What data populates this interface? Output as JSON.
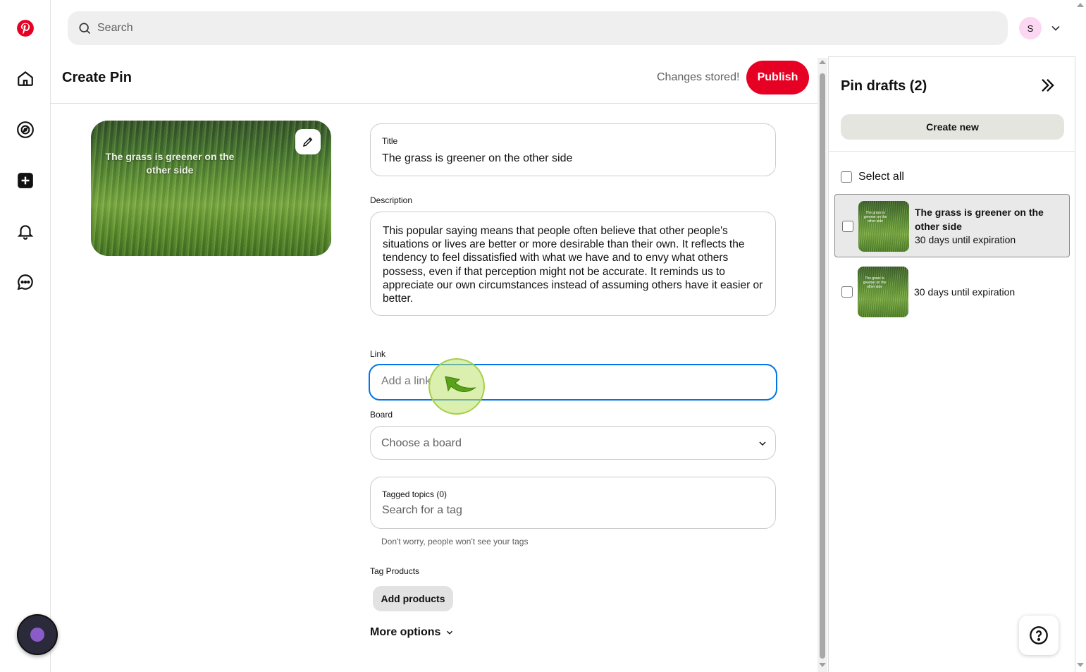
{
  "search": {
    "placeholder": "Search"
  },
  "account": {
    "avatar_initial": "S"
  },
  "header": {
    "title": "Create Pin",
    "status": "Changes stored!",
    "publish_label": "Publish"
  },
  "pin": {
    "overlay_text": "The grass is greener on the other side"
  },
  "form": {
    "title_label": "Title",
    "title_value": "The grass is greener on the other side",
    "description_label": "Description",
    "description_value": "This popular saying means that people often believe that other people's situations or lives are better or more desirable than their own. It reflects the tendency to feel dissatisfied with what we have and to envy what others possess, even if that perception might not be accurate. It reminds us to appreciate our own circumstances instead of assuming others have it easier or better.",
    "link_label": "Link",
    "link_placeholder": "Add a link",
    "board_label": "Board",
    "board_value": "Choose a board",
    "tags_label": "Tagged topics (0)",
    "tags_placeholder": "Search for a tag",
    "tags_hint": "Don't worry, people won't see your tags",
    "products_label": "Tag Products",
    "add_products_label": "Add products",
    "more_options_label": "More options"
  },
  "drafts": {
    "title": "Pin drafts (2)",
    "create_new_label": "Create new",
    "select_all_label": "Select all",
    "items": [
      {
        "name": "The grass is greener on the other side",
        "expiration": "30 days until expiration",
        "thumb_text": "The grass is greener on the other side"
      },
      {
        "name": "",
        "expiration": "30 days until expiration",
        "thumb_text": "The grass is greener on the other side"
      }
    ]
  },
  "colors": {
    "brand": "#e60023",
    "focus": "#0074e8"
  },
  "icons": {
    "rail": [
      "pinterest-logo-icon",
      "home-icon",
      "explore-icon",
      "create-icon",
      "notifications-icon",
      "messages-icon"
    ],
    "search": "search-icon",
    "edit": "pencil-icon",
    "collapse": "double-chevron-right-icon",
    "help": "question-icon"
  }
}
